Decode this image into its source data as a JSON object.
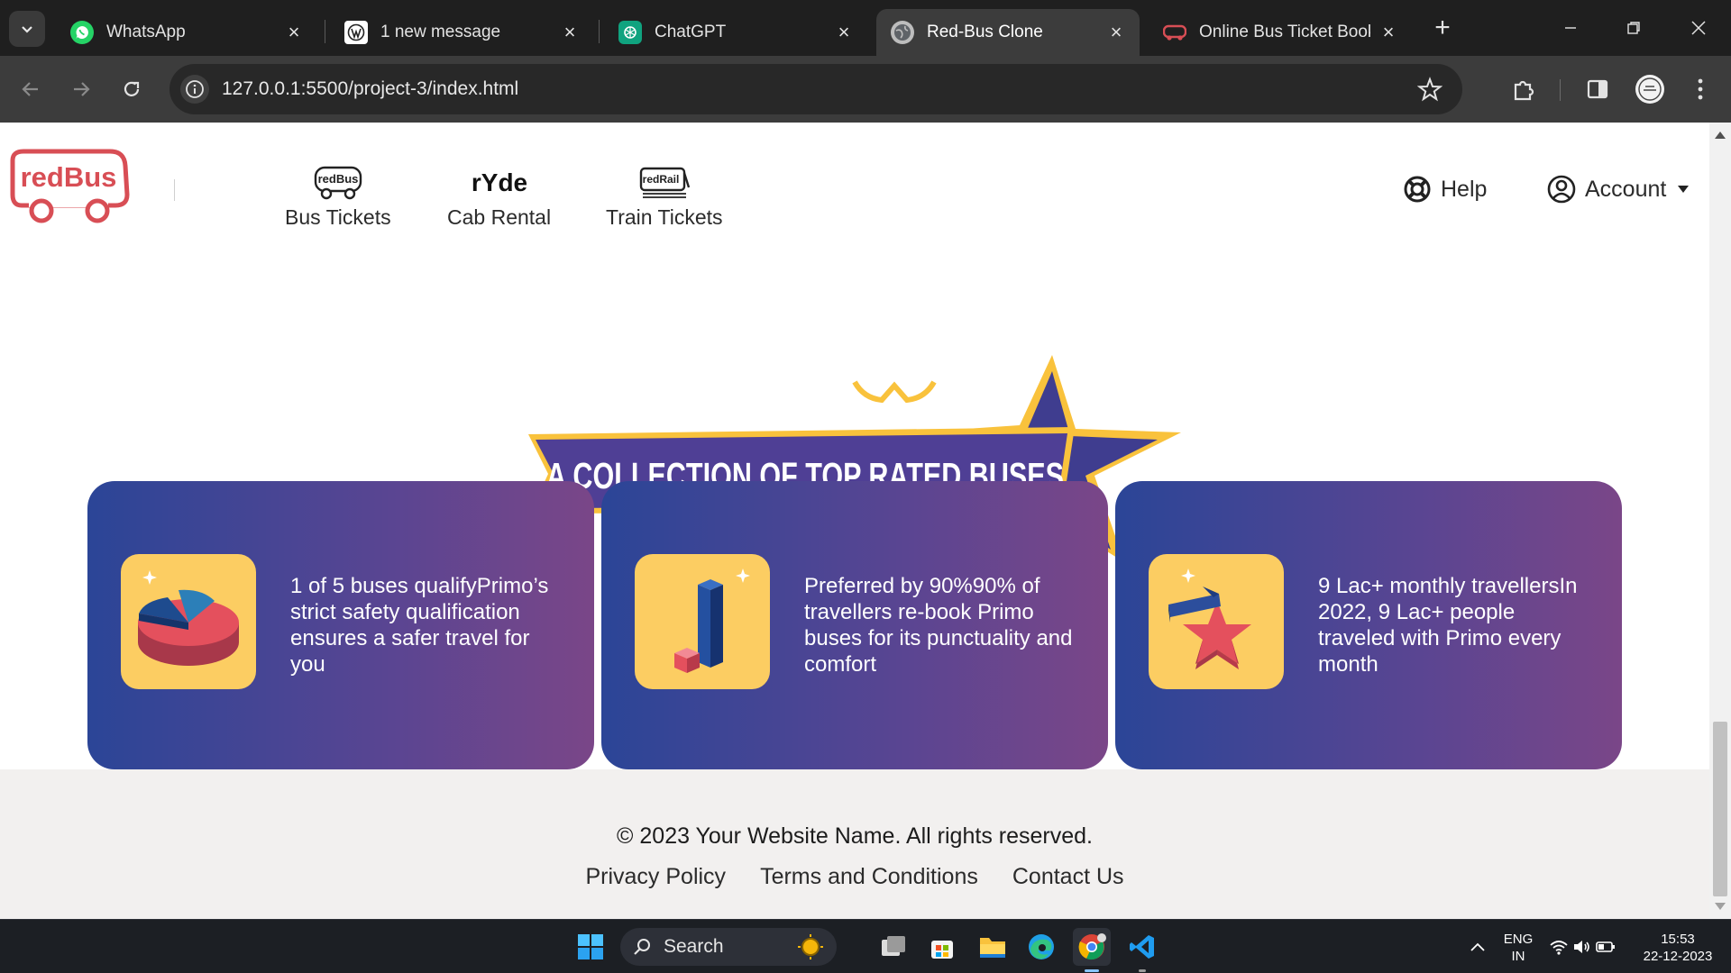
{
  "browser": {
    "tabs": [
      {
        "title": "WhatsApp",
        "favicon": "whatsapp-icon",
        "active": false
      },
      {
        "title": "1 new message",
        "favicon": "wordpress-icon",
        "active": false
      },
      {
        "title": "ChatGPT",
        "favicon": "chatgpt-icon",
        "active": false
      },
      {
        "title": "Red-Bus Clone",
        "favicon": "globe-icon",
        "active": true
      },
      {
        "title": "Online Bus Ticket Book",
        "favicon": "redbus-icon",
        "active": false
      }
    ],
    "url": "127.0.0.1:5500/project-3/index.html"
  },
  "site": {
    "logo_text": "redBus",
    "nav": [
      {
        "label": "Bus Tickets",
        "icon": "redbus-bus-icon",
        "icon_text": "redBus"
      },
      {
        "label": "Cab Rental",
        "icon": "ryde-icon",
        "icon_text": "rYde"
      },
      {
        "label": "Train Tickets",
        "icon": "redrail-icon",
        "icon_text": "redRail"
      }
    ],
    "help_label": "Help",
    "account_label": "Account",
    "banner_text": "A COLLECTION OF TOP RATED BUSES",
    "cards": [
      {
        "icon": "pie-chart-icon",
        "text": "1 of 5 buses qualifyPrimo’s strict safety qualification ensures a safer travel for you"
      },
      {
        "icon": "bar-chart-icon",
        "text": "Preferred by 90%90% of travellers re-book Primo buses for its punctuality and comfort"
      },
      {
        "icon": "star-chart-icon",
        "text": "9 Lac+ monthly travellersIn 2022, 9 Lac+ people traveled with Primo every month"
      }
    ],
    "footer": {
      "copyright": "© 2023 Your Website Name. All rights reserved.",
      "links": [
        "Privacy Policy",
        "Terms and Conditions",
        "Contact Us"
      ]
    }
  },
  "taskbar": {
    "search_label": "Search",
    "language": "ENG",
    "region": "IN",
    "time": "15:53",
    "date": "22-12-2023"
  },
  "colors": {
    "brand_red": "#d84e55",
    "card_gradient_start": "#2b4597",
    "card_gradient_end": "#7a4688",
    "icon_box": "#fccd62",
    "banner_purple": "#3f3d8f",
    "banner_gold": "#f9c23c"
  }
}
